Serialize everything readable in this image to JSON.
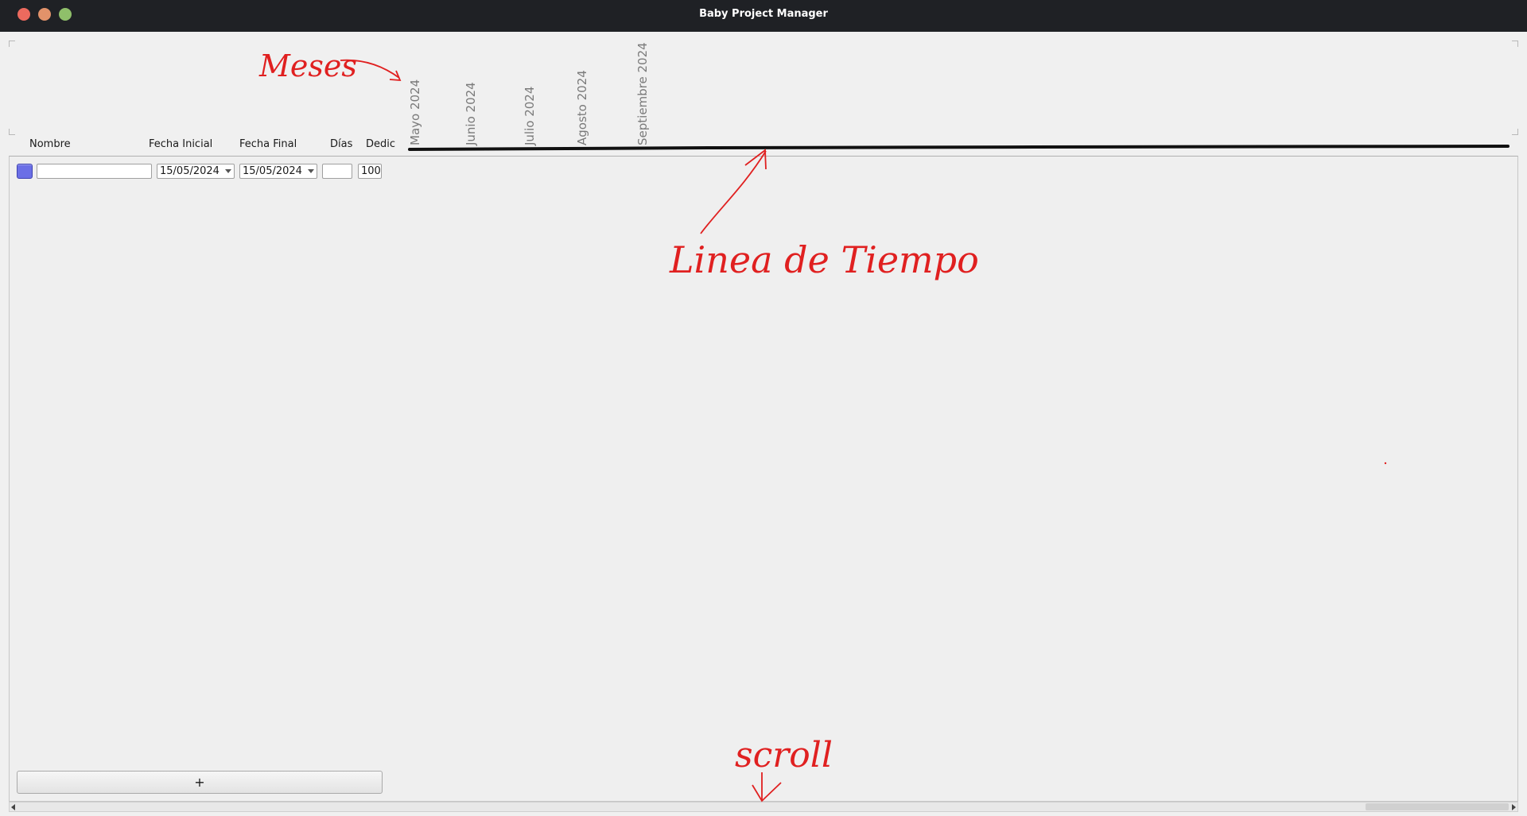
{
  "window": {
    "title": "Baby Project Manager",
    "traffic_colors": {
      "close": "#ec6a5e",
      "minimize": "#e2926a",
      "maximize": "#8fbf6a"
    }
  },
  "columns": {
    "name": "Nombre",
    "start_date": "Fecha Inicial",
    "end_date": "Fecha Final",
    "days": "Días",
    "dedication": "Dedic"
  },
  "months": [
    "Mayo 2024",
    "Junio 2024",
    "Julio 2024",
    "Agosto 2024",
    "Septiembre 2024"
  ],
  "row": {
    "color": "#6b6fe6",
    "name_value": "",
    "start_date_value": "15/05/2024",
    "end_date_value": "15/05/2024",
    "days_value": "",
    "dedication_value": "100"
  },
  "add_button": {
    "label": "+"
  },
  "annotations": {
    "color": "#e02020",
    "months_note": "Meses",
    "timeline_note": "Linea de Tiempo",
    "scroll_note": "scroll"
  }
}
